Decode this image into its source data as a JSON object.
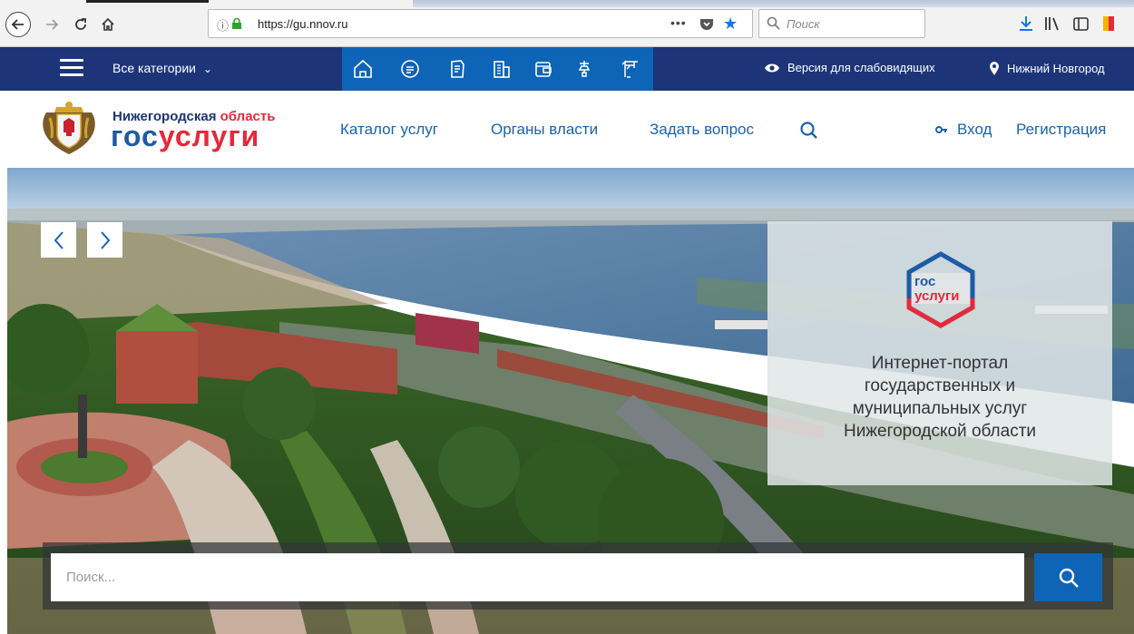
{
  "browser": {
    "url_host": "https://gu.nnov.ru",
    "search_placeholder": "Поиск",
    "more_label": "•••"
  },
  "topnav": {
    "all_categories": "Все категории",
    "category_icons": [
      "home-icon",
      "chat-icon",
      "document-icon",
      "building-icon",
      "wallet-icon",
      "utilities-icon",
      "crane-icon"
    ],
    "impaired_version": "Версия для слабовидящих",
    "city": "Нижний Новгород"
  },
  "header": {
    "brand_line1_part1": "Нижегородская",
    "brand_line1_part2": "область",
    "brand_line2_part1": "гос",
    "brand_line2_part2": "услуги",
    "menu": [
      "Каталог услуг",
      "Органы власти",
      "Задать вопрос"
    ],
    "login": "Вход",
    "register": "Регистрация"
  },
  "hero": {
    "promo_logo_line1": "гос",
    "promo_logo_line2": "услуги",
    "promo_text": [
      "Интернет-портал",
      "государственных и",
      "муниципальных услуг",
      "Нижегородской области"
    ],
    "search_placeholder": "Поиск..."
  },
  "colors": {
    "topnav_bg": "#1d3578",
    "icon_strip_bg": "#0e64b7",
    "brand_red": "#e6293b",
    "brand_blue": "#1d5ba6",
    "link_blue": "#1a62ae",
    "search_button": "#0e64b7"
  }
}
